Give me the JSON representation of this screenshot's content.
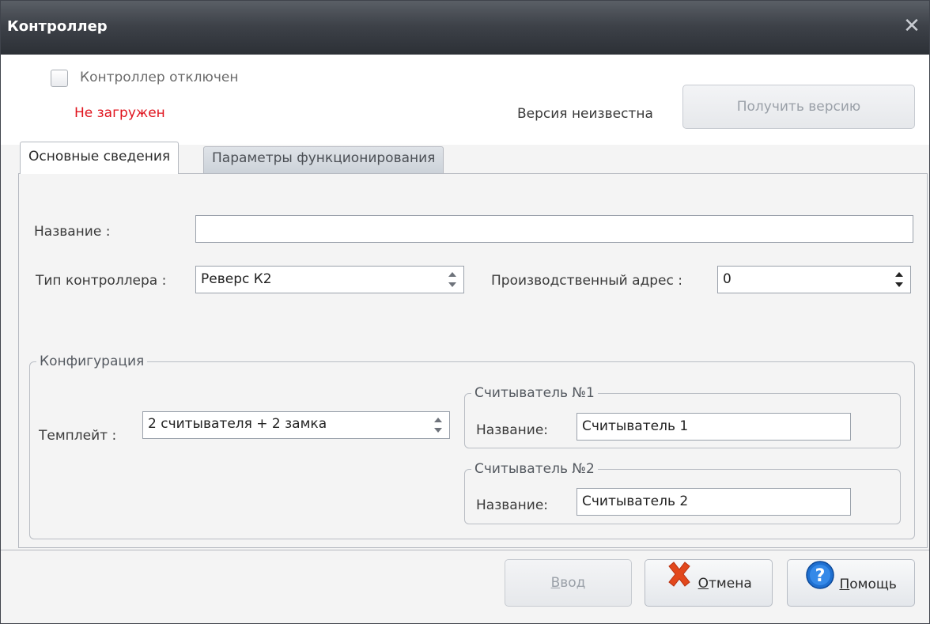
{
  "window": {
    "title": "Контроллер"
  },
  "status": {
    "disabled_label": "Контроллер отключен",
    "load_state": "Не загружен",
    "version_text": "Версия неизвестна",
    "get_version_label": "Получить версию"
  },
  "tabs": [
    {
      "label": "Основные сведения",
      "active": true
    },
    {
      "label": "Параметры функционирования",
      "active": false
    }
  ],
  "form": {
    "name_label": "Название :",
    "name_value": "",
    "type_label": "Тип контроллера :",
    "type_value": "Реверс К2",
    "address_label": "Производственный адрес :",
    "address_value": "0"
  },
  "config": {
    "legend": "Конфигурация",
    "template_label": "Темплейт :",
    "template_value": "2 считывателя + 2 замка",
    "reader1": {
      "legend": "Считыватель №1",
      "name_label": "Название:",
      "name_value": "Считыватель 1"
    },
    "reader2": {
      "legend": "Считыватель №2",
      "name_label": "Название:",
      "name_value": "Считыватель 2"
    }
  },
  "footer": {
    "ok_label": "Ввод",
    "ok_hotkey": "В",
    "ok_rest": "вод",
    "cancel_hotkey": "О",
    "cancel_rest": "тмена",
    "help_hotkey": "П",
    "help_rest": "омощь"
  },
  "colors": {
    "title_bg": "#3e4249",
    "error_text": "#e0141e",
    "accent": "#1e6fd0"
  },
  "icons": {
    "close": "close-icon",
    "cancel": "red-x-icon",
    "help": "question-icon",
    "spin": "spin-arrows-icon"
  }
}
